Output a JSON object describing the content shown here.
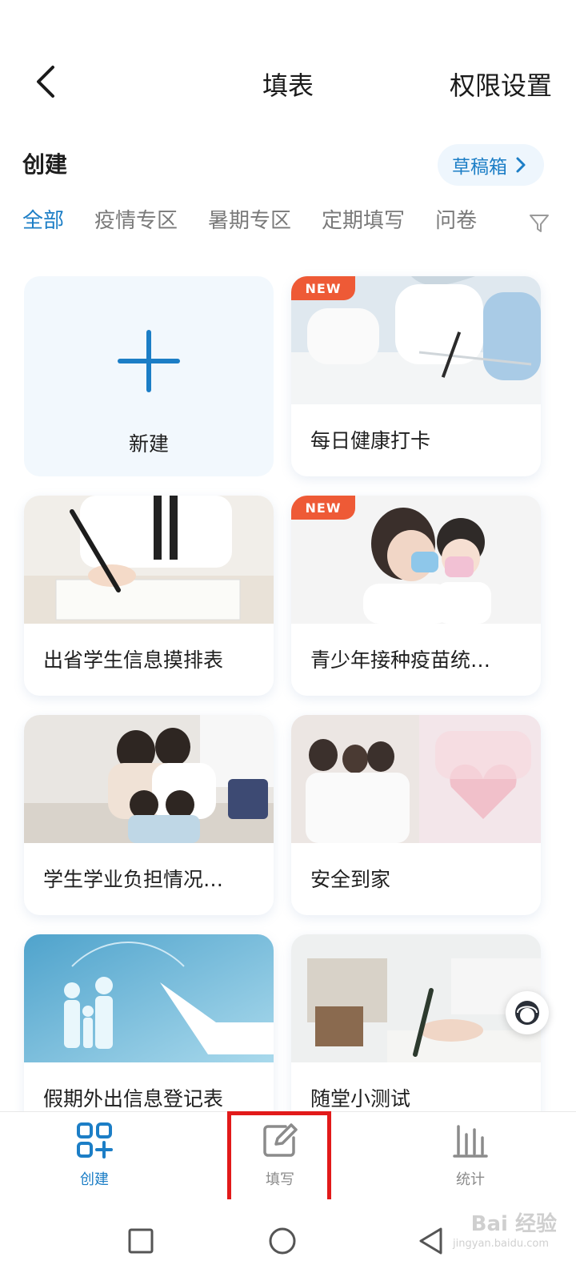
{
  "header": {
    "title": "填表",
    "permission_label": "权限设置"
  },
  "section": {
    "title": "创建",
    "draft_label": "草稿箱"
  },
  "tabs": [
    {
      "label": "全部",
      "active": true
    },
    {
      "label": "疫情专区"
    },
    {
      "label": "暑期专区"
    },
    {
      "label": "定期填写"
    },
    {
      "label": "问卷"
    }
  ],
  "cards": [
    {
      "label": "新建"
    },
    {
      "label": "每日健康打卡",
      "badge": "NEW"
    },
    {
      "label": "出省学生信息摸排表"
    },
    {
      "label": "青少年接种疫苗统…",
      "badge": "NEW"
    },
    {
      "label": "学生学业负担情况…"
    },
    {
      "label": "安全到家"
    },
    {
      "label": "假期外出信息登记表"
    },
    {
      "label": "随堂小测试"
    }
  ],
  "bottom_nav": [
    {
      "label": "创建",
      "active": true
    },
    {
      "label": "填写"
    },
    {
      "label": "统计"
    }
  ],
  "watermark": {
    "text": "Bai 经验",
    "sub": "jingyan.baidu.com"
  },
  "colors": {
    "accent": "#1c7ec6",
    "badge": "#ee5a36",
    "highlight": "#e21a1a"
  }
}
